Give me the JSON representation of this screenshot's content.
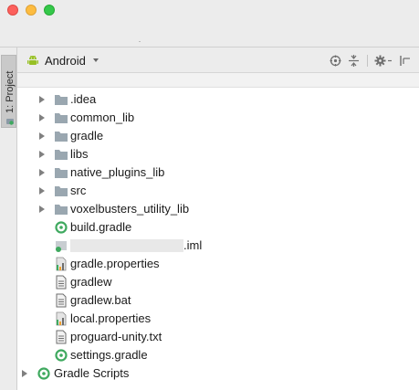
{
  "sidebar": {
    "project_tab_label": "1: Project"
  },
  "panel": {
    "view_mode": "Android"
  },
  "tree": {
    "folders": [
      ".idea",
      "common_lib",
      "gradle",
      "libs",
      "native_plugins_lib",
      "src",
      "voxelbusters_utility_lib"
    ],
    "files": [
      "build.gradle",
      ".iml",
      "gradle.properties",
      "gradlew",
      "gradlew.bat",
      "local.properties",
      "proguard-unity.txt",
      "settings.gradle"
    ],
    "root_section": "Gradle Scripts"
  },
  "colors": {
    "folder": "#9aa7b0",
    "gradle_green": "#3fa95f",
    "android_green": "#97c024",
    "properties_bar": "#f0a030"
  }
}
